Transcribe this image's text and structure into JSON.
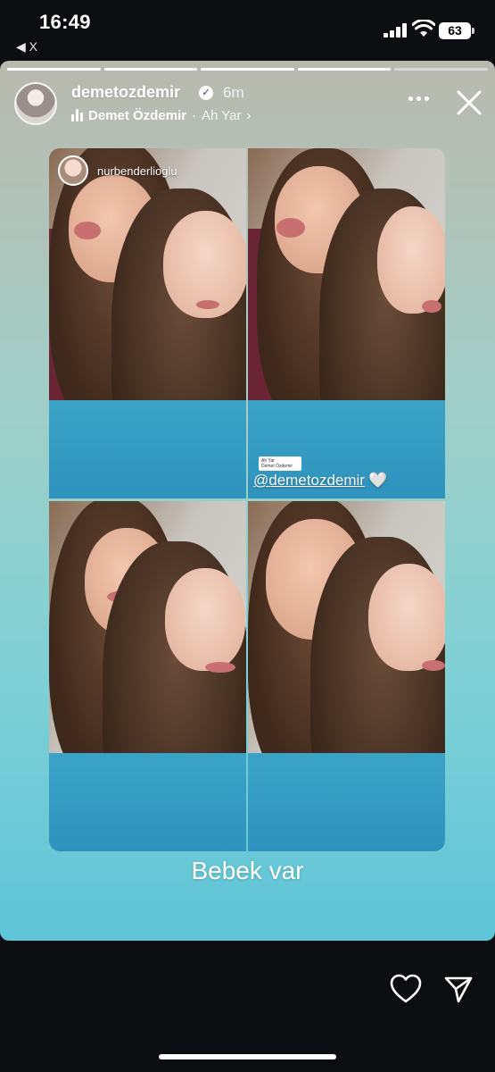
{
  "status_bar": {
    "time": "16:49",
    "back_app": "◀ X",
    "battery": "63"
  },
  "story": {
    "username": "demetozdemir",
    "verified_icon": "verified-check-icon",
    "time_ago": "6m",
    "music": {
      "artist": "Demet Özdemir",
      "separator": "·",
      "song": "Ah Yar",
      "chevron": "›"
    },
    "progress_segments": [
      {
        "state": "done"
      },
      {
        "state": "done"
      },
      {
        "state": "done"
      },
      {
        "state": "done"
      },
      {
        "state": "pending"
      }
    ],
    "photos": {
      "mention_user": "nurbenderlioglu",
      "sticker_title": "Ah Yar",
      "sticker_artist": "Demet Özdemir",
      "mention_tag": "@demetozdemir",
      "heart": "🤍"
    },
    "caption": "Bebek var"
  },
  "colors": {
    "background": "#0b0d10",
    "gradient_top": "#b9b9ae",
    "gradient_bottom": "#5ec5d8"
  }
}
